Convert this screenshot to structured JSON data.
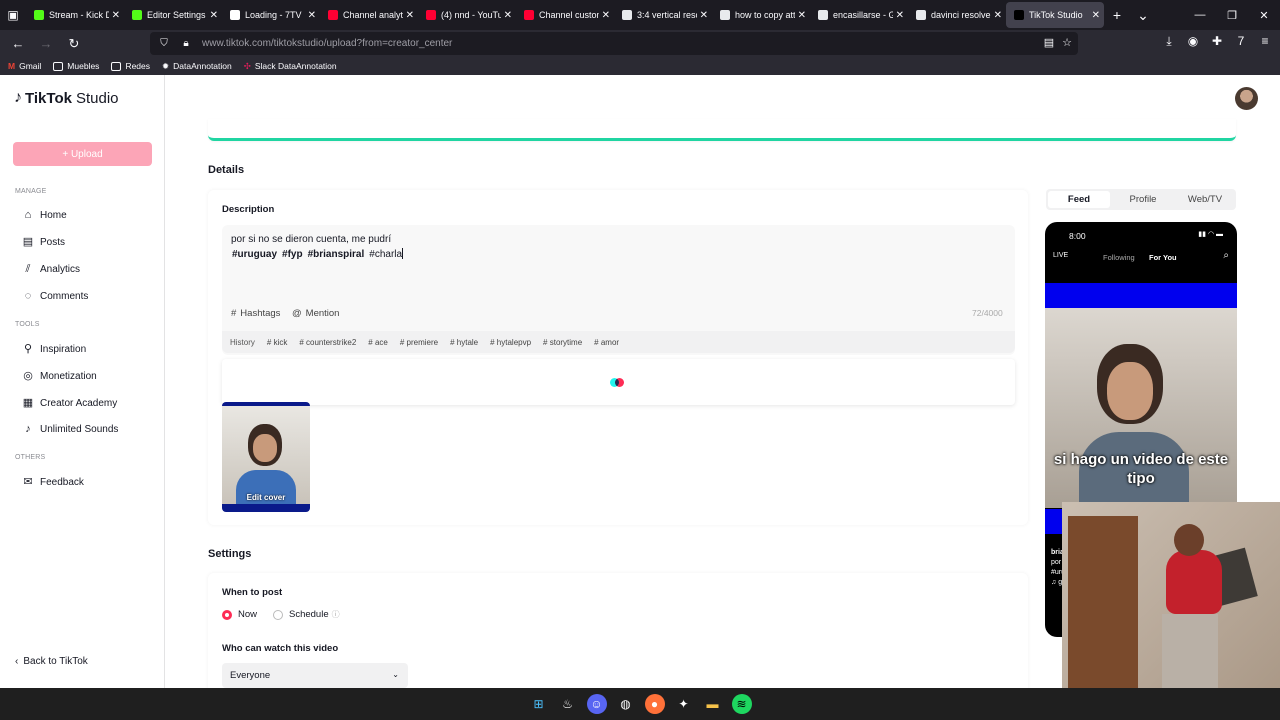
{
  "browser": {
    "tabs": [
      {
        "title": "Stream - Kick Da",
        "color": "#53fc18"
      },
      {
        "title": "Editor Settings -",
        "color": "#53fc18"
      },
      {
        "title": "Loading - 7TV",
        "color": "#ffffff"
      },
      {
        "title": "Channel analytic",
        "color": "#ff0033"
      },
      {
        "title": "(4) nnd - YouTub",
        "color": "#ff0033"
      },
      {
        "title": "Channel custom",
        "color": "#ff0033"
      },
      {
        "title": "3:4 vertical resol",
        "color": "#e8eaed"
      },
      {
        "title": "how to copy attr",
        "color": "#e8eaed"
      },
      {
        "title": "encasillarse - Go",
        "color": "#e8eaed"
      },
      {
        "title": "davinci resolve n",
        "color": "#e8eaed"
      },
      {
        "title": "TikTok Studio",
        "color": "#000000"
      }
    ],
    "url": "www.tiktok.com/tiktokstudio/upload?from=creator_center",
    "bookmarks": [
      "Gmail",
      "Muebles",
      "Redes",
      "DataAnnotation",
      "Slack DataAnnotation"
    ]
  },
  "sidebar": {
    "logo": "TikTok",
    "logo_suffix": "Studio",
    "upload": "+ Upload",
    "manage_label": "MANAGE",
    "manage_items": [
      "Home",
      "Posts",
      "Analytics",
      "Comments"
    ],
    "tools_label": "TOOLS",
    "tools_items": [
      "Inspiration",
      "Monetization",
      "Creator Academy",
      "Unlimited Sounds"
    ],
    "others_label": "OTHERS",
    "others_items": [
      "Feedback"
    ],
    "back": "Back to TikTok"
  },
  "details": {
    "title": "Details",
    "description_label": "Description",
    "line1": "por si no se dieron cuenta, me pudrí",
    "hashtags": [
      "#uruguay",
      "#fyp",
      "#brianspiral",
      "#charla"
    ],
    "hashtags_btn": "Hashtags",
    "mention_btn": "Mention",
    "counter": "72/4000",
    "history_label": "History",
    "history": [
      "# kick",
      "# counterstrike2",
      "# ace",
      "# premiere",
      "# hytale",
      "# hytalepvp",
      "# storytime",
      "# amor"
    ],
    "edit_cover": "Edit cover"
  },
  "settings": {
    "title": "Settings",
    "when_label": "When to post",
    "now": "Now",
    "schedule": "Schedule",
    "who_label": "Who can watch this video",
    "who_value": "Everyone"
  },
  "preview": {
    "tabs": [
      "Feed",
      "Profile",
      "Web/TV"
    ],
    "active_tab": "Feed",
    "time": "8:00",
    "following": "Following",
    "for_you": "For You",
    "caption": "si hago un video de este tipo",
    "meta_lines": [
      "bria",
      "por",
      "#uru",
      "♫ g"
    ]
  },
  "colors": {
    "accent": "#fe2c55",
    "upload_btn": "#fca5b7",
    "progress": "#20d5a2",
    "spinner_cyan": "#25f4ee"
  }
}
